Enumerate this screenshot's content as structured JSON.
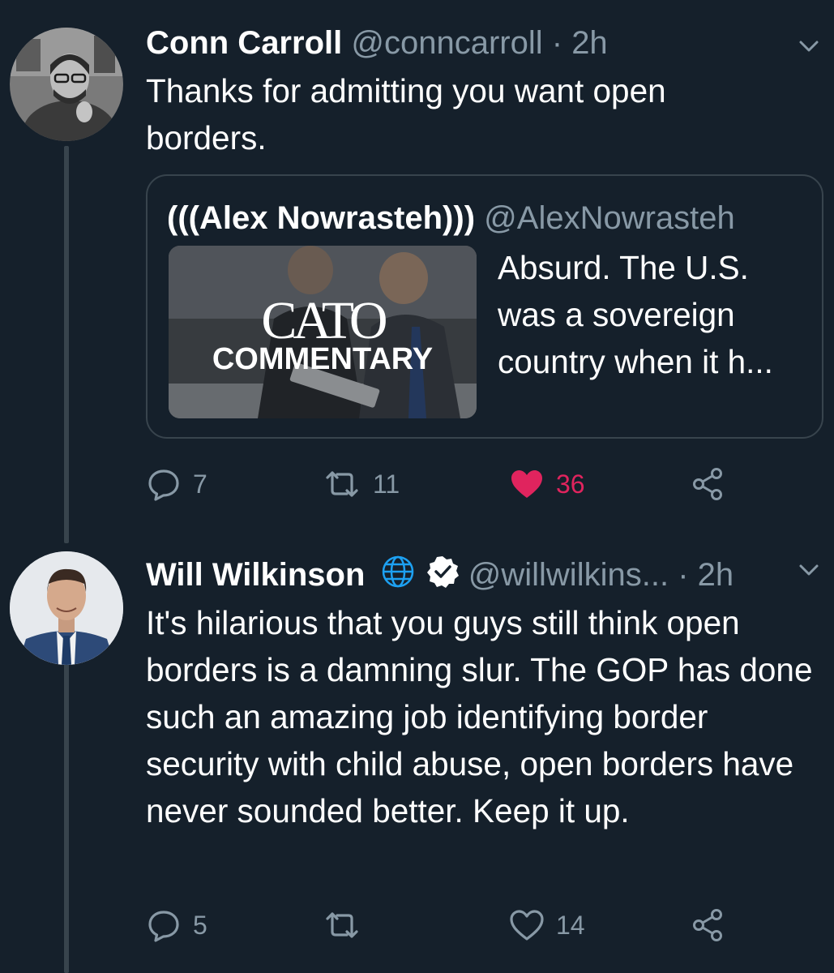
{
  "tweets": [
    {
      "author": "Conn Carroll",
      "handle": "@conncarroll",
      "separator": "·",
      "time": "2h",
      "text": "Thanks for admitting you want open borders.",
      "quote": {
        "author": "(((Alex Nowrasteh)))",
        "handle": "@AlexNowrasteh",
        "thumbnail_title": "CATO",
        "thumbnail_subtitle": "COMMENTARY",
        "text": "Absurd. The U.S. was a sovereign country when it h..."
      },
      "actions": {
        "replies": "7",
        "retweets": "11",
        "likes": "36",
        "liked": true
      }
    },
    {
      "author": "Will Wilkinson",
      "handle": "@willwilkins...",
      "separator": "·",
      "time": "2h",
      "text": "It's hilarious that you guys still think open borders is a damning slur. The GOP has done such an amazing job identifying border security with child abuse, open borders have never sounded better. Keep it up.",
      "badges": [
        "globe-icon",
        "verified-icon"
      ],
      "actions": {
        "replies": "5",
        "retweets": "",
        "likes": "14",
        "liked": false
      }
    }
  ],
  "colors": {
    "background": "#15202b",
    "secondary_text": "#8899a6",
    "border": "#38444d",
    "like_active": "#e0245e",
    "link_blue": "#1da1f2"
  }
}
